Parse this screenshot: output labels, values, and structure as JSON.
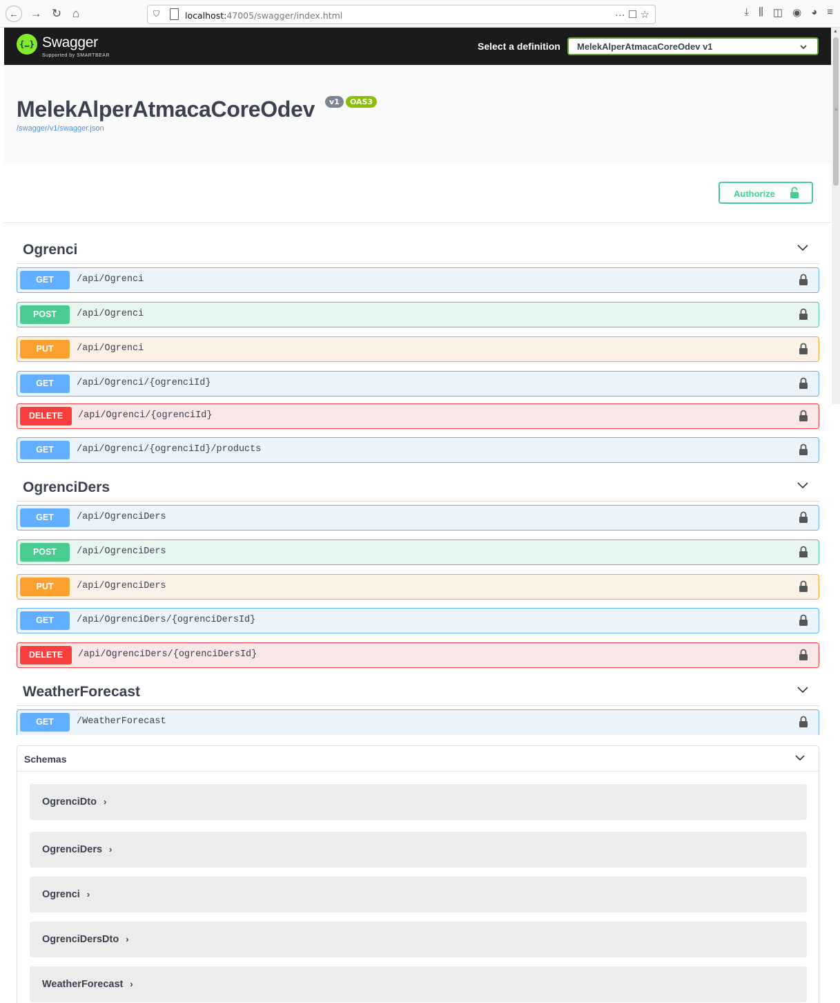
{
  "browser": {
    "url_host": "localhost:",
    "url_rest": "47005/swagger/index.html",
    "url_actions": "··· ☐ ☆"
  },
  "topbar": {
    "logo_glyph": "{…}",
    "logo_text": "Swagger",
    "logo_sub": "Supported by SMARTBEAR",
    "definition_label": "Select a definition",
    "definition_value": "MelekAlperAtmacaCoreOdev v1"
  },
  "info": {
    "title": "MelekAlperAtmacaCoreOdev",
    "version_badge": "v1",
    "oas_badge": "OAS3",
    "json_link": "/swagger/v1/swagger.json"
  },
  "authorize": {
    "label": "Authorize"
  },
  "tags": [
    {
      "name": "Ogrenci"
    },
    {
      "name": "OgrenciDers"
    },
    {
      "name": "WeatherForecast"
    }
  ],
  "operations": [
    {
      "method": "GET",
      "path": "/api/Ogrenci"
    },
    {
      "method": "POST",
      "path": "/api/Ogrenci"
    },
    {
      "method": "PUT",
      "path": "/api/Ogrenci"
    },
    {
      "method": "GET",
      "path": "/api/Ogrenci/{ogrenciId}"
    },
    {
      "method": "DELETE",
      "path": "/api/Ogrenci/{ogrenciId}"
    },
    {
      "method": "GET",
      "path": "/api/Ogrenci/{ogrenciId}/products"
    },
    {
      "method": "GET",
      "path": "/api/OgrenciDers"
    },
    {
      "method": "POST",
      "path": "/api/OgrenciDers"
    },
    {
      "method": "PUT",
      "path": "/api/OgrenciDers"
    },
    {
      "method": "GET",
      "path": "/api/OgrenciDers/{ogrenciDersId}"
    },
    {
      "method": "DELETE",
      "path": "/api/OgrenciDers/{ogrenciDersId}"
    },
    {
      "method": "GET",
      "path": "/WeatherForecast"
    }
  ],
  "schemas": {
    "title": "Schemas",
    "models": [
      "OgrenciDto",
      "OgrenciDers",
      "Ogrenci",
      "OgrenciDersDto",
      "WeatherForecast"
    ]
  },
  "colors": {
    "get": "#61affe",
    "post": "#49cc90",
    "put": "#fca130",
    "delete": "#f93e3e",
    "topbar": "#1b1b1b",
    "brand": "#85ea2d"
  }
}
